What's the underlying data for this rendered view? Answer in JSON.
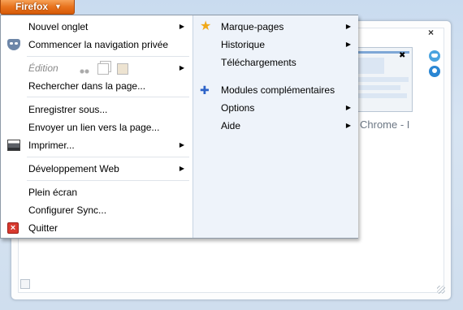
{
  "app_button": {
    "label": "Firefox"
  },
  "menu": {
    "left": {
      "new_tab": "Nouvel onglet",
      "private_browsing": "Commencer la navigation privée",
      "edit": "Édition",
      "find": "Rechercher dans la page...",
      "save_as": "Enregistrer sous...",
      "send_link": "Envoyer un lien vers la page...",
      "print": "Imprimer...",
      "web_dev": "Développement Web",
      "fullscreen": "Plein écran",
      "sync": "Configurer Sync...",
      "quit": "Quitter"
    },
    "right": {
      "bookmarks": "Marque-pages",
      "history": "Historique",
      "downloads": "Téléchargements",
      "addons": "Modules complémentaires",
      "options": "Options",
      "help": "Aide"
    }
  },
  "background": {
    "close_label": "×",
    "thumbnail_label": "Chrome - I"
  },
  "colors": {
    "app_button": "#e8731d",
    "menu_right_bg": "#eef3fa",
    "quit_icon": "#d83a2f"
  }
}
